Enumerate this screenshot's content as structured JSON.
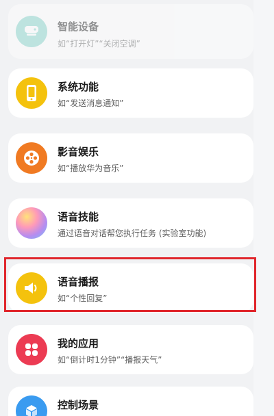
{
  "items": [
    {
      "title": "智能设备",
      "subtitle": "如“打开灯”“关闭空调”",
      "icon": "smart-device-icon",
      "color": "#7fd1c6"
    },
    {
      "title": "系统功能",
      "subtitle": "如“发送消息通知”",
      "icon": "phone-icon",
      "color": "#f4c20d"
    },
    {
      "title": "影音娱乐",
      "subtitle": "如“播放华为音乐”",
      "icon": "film-reel-icon",
      "color": "#f07a22"
    },
    {
      "title": "语音技能",
      "subtitle": "通过语音对话帮您执行任务 (实验室功能)",
      "icon": "voice-skill-orb-icon",
      "color": "#c98be8"
    },
    {
      "title": "语音播报",
      "subtitle": "如“个性回复”",
      "icon": "speaker-icon",
      "color": "#f4c20d"
    },
    {
      "title": "我的应用",
      "subtitle": "如“倒计时1分钟”“播报天气”",
      "icon": "app-grid-icon",
      "color": "#ec3b53"
    },
    {
      "title": "控制场景",
      "subtitle": "",
      "icon": "cube-icon",
      "color": "#3a9bf0"
    }
  ]
}
